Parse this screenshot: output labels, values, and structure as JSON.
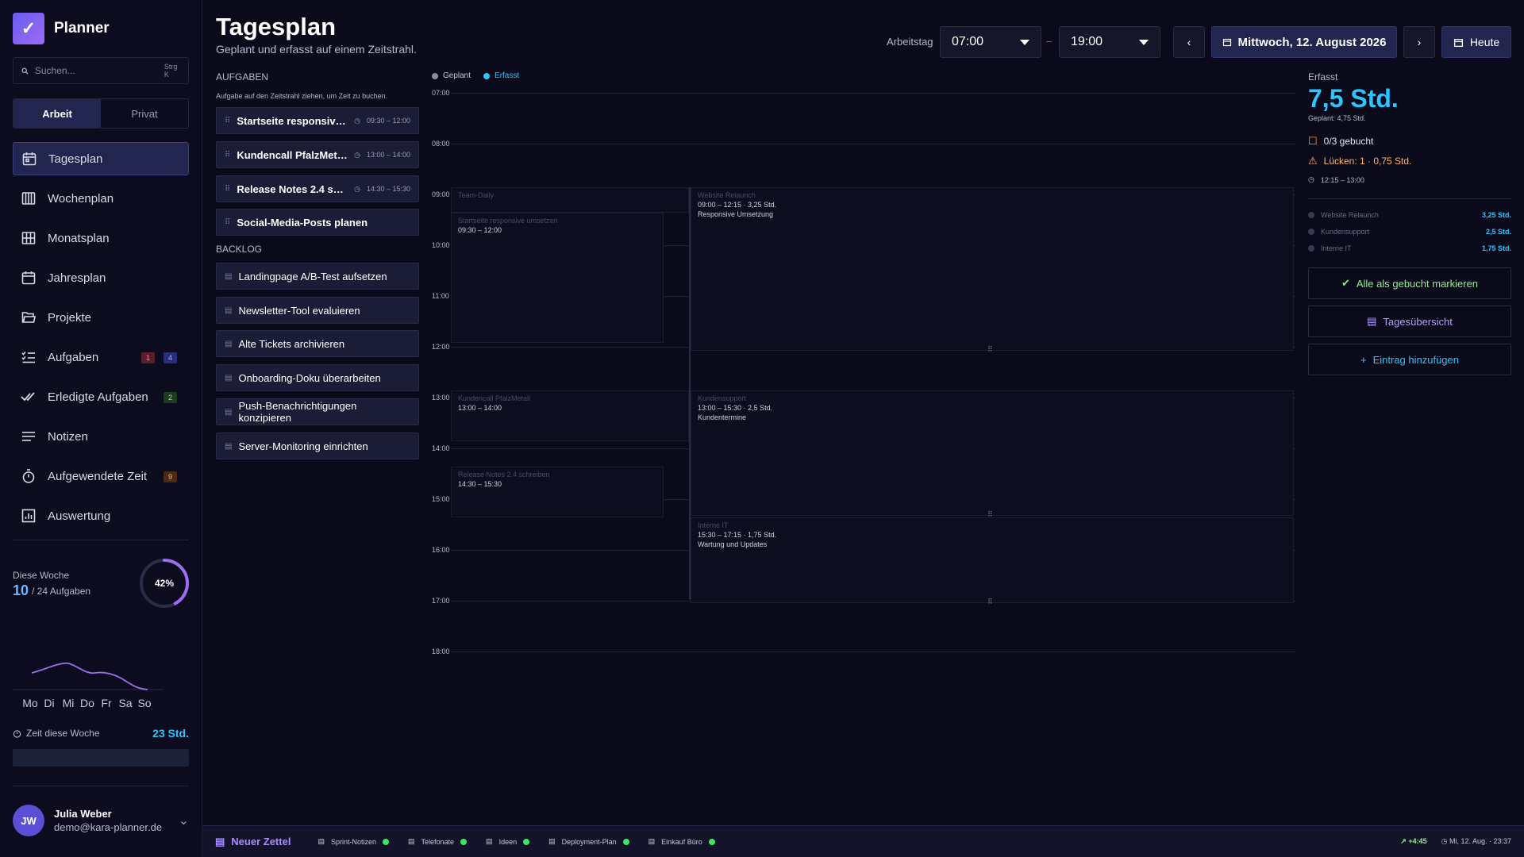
{
  "app": {
    "name": "Planner"
  },
  "search": {
    "placeholder": "Suchen...",
    "shortcut": "Strg K"
  },
  "segments": [
    {
      "label": "Arbeit",
      "active": true
    },
    {
      "label": "Privat",
      "active": false
    }
  ],
  "nav": [
    {
      "label": "Tagesplan",
      "icon": "calendar-day-icon",
      "active": true
    },
    {
      "label": "Wochenplan",
      "icon": "calendar-week-icon"
    },
    {
      "label": "Monatsplan",
      "icon": "calendar-grid-icon"
    },
    {
      "label": "Jahresplan",
      "icon": "calendar-icon"
    },
    {
      "label": "Projekte",
      "icon": "folder-icon"
    },
    {
      "label": "Aufgaben",
      "icon": "checklist-icon",
      "badges": [
        "1",
        "4"
      ]
    },
    {
      "label": "Erledigte Aufgaben",
      "icon": "double-check-icon",
      "badges": [
        "2"
      ]
    },
    {
      "label": "Notizen",
      "icon": "notes-icon"
    },
    {
      "label": "Aufgewendete Zeit",
      "icon": "stopwatch-icon",
      "badges": [
        "9"
      ]
    },
    {
      "label": "Auswertung",
      "icon": "chart-icon"
    }
  ],
  "week": {
    "label": "Diese Woche",
    "done": "10",
    "of": "/ 24 Aufgaben",
    "percent": "42%",
    "progress": 0.42,
    "days": [
      "Mo",
      "Di",
      "Mi",
      "Do",
      "Fr",
      "Sa",
      "So"
    ],
    "time_label": "Zeit diese Woche",
    "time_value": "23 Std."
  },
  "user": {
    "initials": "JW",
    "name": "Julia Weber",
    "email": "demo@kara-planner.de"
  },
  "header": {
    "title": "Tagesplan",
    "subtitle": "Geplant und erfasst auf einem Zeitstrahl.",
    "workday_label": "Arbeitstag",
    "start": "07:00",
    "end": "19:00",
    "dash": "–",
    "date": "Mittwoch, 12. August 2026",
    "today": "Heute"
  },
  "tasks": {
    "title": "AUFGABEN",
    "hint": "Aufgabe auf den Zeitstrahl ziehen, um Zeit zu buchen.",
    "items": [
      {
        "name": "Startseite responsive ...",
        "time": "09:30 – 12:00"
      },
      {
        "name": "Kundencall PfalzMetall",
        "time": "13:00 – 14:00"
      },
      {
        "name": "Release Notes 2.4 sch...",
        "time": "14:30 – 15:30"
      },
      {
        "name": "Social-Media-Posts planen",
        "time": ""
      }
    ]
  },
  "backlog": {
    "title": "BACKLOG",
    "items": [
      "Landingpage A/B-Test aufsetzen",
      "Newsletter-Tool evaluieren",
      "Alte Tickets archivieren",
      "Onboarding-Doku überarbeiten",
      "Push-Benachrichtigungen konzipieren",
      "Server-Monitoring einrichten"
    ]
  },
  "timeline": {
    "legend": [
      {
        "label": "Geplant",
        "color": "#8a8aa0"
      },
      {
        "label": "Erfasst",
        "color": "#2ec5ff"
      }
    ],
    "hours": [
      "07:00",
      "08:00",
      "09:00",
      "10:00",
      "11:00",
      "12:00",
      "13:00",
      "14:00",
      "15:00",
      "16:00",
      "17:00",
      "18:00"
    ],
    "planned": [
      {
        "title": "Team-Daily",
        "time": ""
      },
      {
        "title": "Startseite responsive umsetzen",
        "time": "09:30 – 12:00"
      },
      {
        "title": "Kundencall PfalzMetall",
        "time": "13:00 – 14:00"
      },
      {
        "title": "Release Notes 2.4 schreiben",
        "time": "14:30 – 15:30"
      }
    ],
    "logged": [
      {
        "title": "Website Relaunch",
        "time": "09:00 – 12:15 · 3,25 Std.",
        "desc": "Responsive Umsetzung"
      },
      {
        "title": "Kundensupport",
        "time": "13:00 – 15:30 · 2,5 Std.",
        "desc": "Kundentermine"
      },
      {
        "title": "Interne IT",
        "time": "15:30 – 17:15 · 1,75 Std.",
        "desc": "Wartung und Updates"
      }
    ]
  },
  "summary": {
    "label": "Erfasst",
    "value": "7,5 Std.",
    "planned": "Geplant: 4,75 Std.",
    "booked": "0/3 gebucht",
    "gaps": "Lücken: 1 · 0,75 Std.",
    "gap_time": "12:15 – 13:00",
    "projects": [
      {
        "name": "Website Relaunch",
        "value": "3,25 Std."
      },
      {
        "name": "Kundensupport",
        "value": "2,5 Std."
      },
      {
        "name": "Interne IT",
        "value": "1,75 Std."
      }
    ],
    "actions": [
      "Alle als gebucht markieren",
      "Tagesübersicht",
      "Eintrag hinzufügen"
    ]
  },
  "bottom": {
    "new": "Neuer Zettel",
    "notes": [
      "Sprint-Notizen",
      "Telefonate",
      "Ideen",
      "Deployment-Plan",
      "Einkauf Büro"
    ],
    "delta": "+4:45",
    "datetime": "Mi, 12. Aug. · 23:37"
  },
  "colors": {
    "accent": "#2ec5ff",
    "primary": "#22264f",
    "bg": "#0a0a1a"
  }
}
